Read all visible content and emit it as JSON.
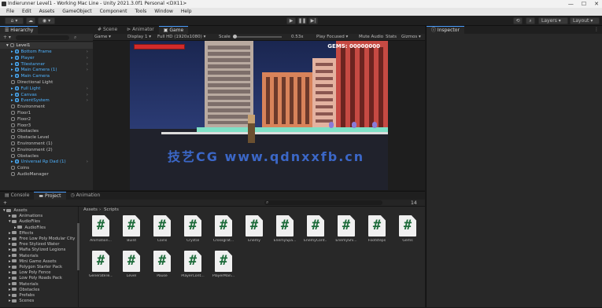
{
  "window": {
    "title": "Indierunner Level1 - Working Mac Line - Unity 2021.3.0f1 Personal <DX11>",
    "controls": [
      "—",
      "☐",
      "✕"
    ]
  },
  "menu": [
    "File",
    "Edit",
    "Assets",
    "GameObject",
    "Component",
    "Tools",
    "Window",
    "Help"
  ],
  "toolbar": {
    "account_label": "⌂",
    "cloud_label": "☁",
    "layers_label": "Layers",
    "layout_label": "Layout",
    "search_icon": "search-icon",
    "history_icon": "history-icon"
  },
  "hierarchy": {
    "tab_label": "Hierarchy",
    "root": "Level1",
    "items": [
      {
        "label": "Bottom Frame",
        "blue": true,
        "arrow": true
      },
      {
        "label": "Player",
        "blue": true,
        "arrow": true
      },
      {
        "label": "Tilestanner",
        "blue": true,
        "arrow": true
      },
      {
        "label": "Main Camera (1)",
        "blue": true,
        "arrow": true
      },
      {
        "label": "Main Camera",
        "blue": true,
        "arrow": false
      },
      {
        "label": "Directional Light",
        "blue": false,
        "arrow": false
      },
      {
        "label": "Full Light",
        "blue": true,
        "arrow": true
      },
      {
        "label": "Canvas",
        "blue": true,
        "arrow": true
      },
      {
        "label": "EventSystem",
        "blue": true,
        "arrow": true
      },
      {
        "label": "Environment",
        "blue": false,
        "arrow": false
      },
      {
        "label": "Floor1",
        "blue": false,
        "arrow": false
      },
      {
        "label": "Floor2",
        "blue": false,
        "arrow": false
      },
      {
        "label": "Floor3",
        "blue": false,
        "arrow": false
      },
      {
        "label": "Obstacles",
        "blue": false,
        "arrow": false
      },
      {
        "label": "Obstacle Level",
        "blue": false,
        "arrow": false
      },
      {
        "label": "Environment (1)",
        "blue": false,
        "arrow": false
      },
      {
        "label": "Environment (2)",
        "blue": false,
        "arrow": false
      },
      {
        "label": "Obstacles",
        "blue": false,
        "arrow": false
      },
      {
        "label": "Universal Rp Dad (1)",
        "blue": true,
        "arrow": true
      },
      {
        "label": "Coins",
        "blue": false,
        "arrow": false
      },
      {
        "label": "AudioManager",
        "blue": false,
        "arrow": false
      }
    ]
  },
  "scene": {
    "tabs": [
      "Scene",
      "Animator",
      "Game"
    ],
    "active_tab": "Game",
    "bar": {
      "display": "Game",
      "target": "Display 1",
      "resolution": "Full HD (1920x1080)",
      "scale_label": "Scale",
      "scale_value": "0.53x",
      "play_focused": "Play Focused",
      "mute_audio": "Mute Audio",
      "stats": "Stats",
      "gizmos": "Gizmos"
    },
    "hud": {
      "gems": "GEMS: 00000000"
    }
  },
  "inspector": {
    "tab_label": "Inspector"
  },
  "bottom": {
    "tabs": [
      "Console",
      "Project",
      "Animation"
    ],
    "active_tab": "Project",
    "add_label": "+",
    "hidden_count": "14",
    "breadcrumb": [
      "Assets",
      "Scripts"
    ],
    "tree": [
      {
        "label": "Assets",
        "indent": 0,
        "open": true
      },
      {
        "label": "Animations",
        "indent": 1,
        "open": false
      },
      {
        "label": "AudioFiles",
        "indent": 1,
        "open": true
      },
      {
        "label": "AudioFiles",
        "indent": 2,
        "open": false
      },
      {
        "label": "Effects",
        "indent": 1,
        "open": false
      },
      {
        "label": "Free Low Poly Modular City",
        "indent": 1,
        "open": false
      },
      {
        "label": "Free Stylized Water",
        "indent": 1,
        "open": false
      },
      {
        "label": "Mafia Stylized Legions",
        "indent": 1,
        "open": false
      },
      {
        "label": "Materials",
        "indent": 1,
        "open": false
      },
      {
        "label": "Mini Game Assets",
        "indent": 1,
        "open": false
      },
      {
        "label": "Polygon Starter Pack",
        "indent": 1,
        "open": false
      },
      {
        "label": "Low Poly Fence",
        "indent": 1,
        "open": false
      },
      {
        "label": "Low Poly Roads Pack",
        "indent": 1,
        "open": false
      },
      {
        "label": "Materials",
        "indent": 1,
        "open": false
      },
      {
        "label": "Obstacles",
        "indent": 1,
        "open": false
      },
      {
        "label": "Prefabs",
        "indent": 1,
        "open": false
      },
      {
        "label": "Scenes",
        "indent": 1,
        "open": false
      }
    ],
    "assets": [
      "Animation...",
      "Build",
      "Coins",
      "Crystal",
      "Crossgrat...",
      "Enemy",
      "EnemySpa...",
      "EnemyCont...",
      "EnemyShi...",
      "Footsteps",
      "Gems",
      "GenerateTe...",
      "Level",
      "Pause",
      "PlayerCont...",
      "PlayerMan..."
    ]
  },
  "watermark": "技艺CG   www.qdnxxfb.cn"
}
